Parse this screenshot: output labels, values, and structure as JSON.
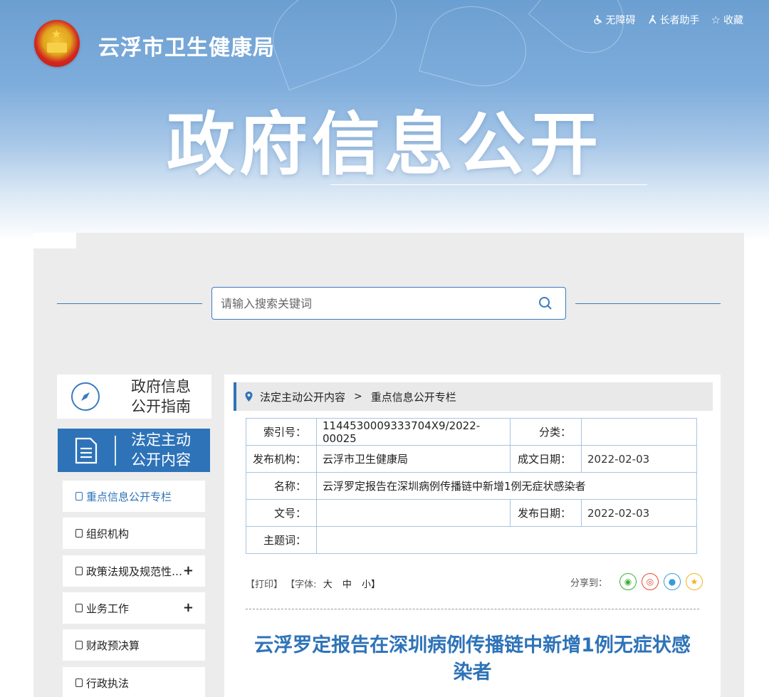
{
  "header": {
    "site_title": "云浮市卫生健康局",
    "hero_title": "政府信息公开",
    "toolbar": [
      {
        "icon": "wheelchair-icon",
        "label": "无障碍"
      },
      {
        "icon": "elderly-icon",
        "label": "长者助手"
      },
      {
        "icon": "star-outline-icon",
        "label": "收藏"
      }
    ]
  },
  "search": {
    "placeholder": "请输入搜索关键词",
    "value": ""
  },
  "sidebar": {
    "guide_label": "政府信息公开指南",
    "legal_label": "法定主动公开内容",
    "items": [
      {
        "label": "重点信息公开专栏",
        "active": true,
        "expand": ""
      },
      {
        "label": "组织机构",
        "active": false,
        "expand": ""
      },
      {
        "label": "政策法规及规范性…",
        "active": false,
        "expand": "+"
      },
      {
        "label": "业务工作",
        "active": false,
        "expand": "+"
      },
      {
        "label": "财政预决算",
        "active": false,
        "expand": ""
      },
      {
        "label": "行政执法",
        "active": false,
        "expand": ""
      }
    ]
  },
  "breadcrumb": {
    "level1": "法定主动公开内容",
    "separator": ">",
    "level2": "重点信息公开专栏"
  },
  "meta": {
    "index_label": "索引号：",
    "index_value": "1144530009333704X9/2022-00025",
    "category_label": "分类：",
    "category_value": "",
    "publisher_label": "发布机构：",
    "publisher_value": "云浮市卫生健康局",
    "written_date_label": "成文日期：",
    "written_date_value": "2022-02-03",
    "name_label": "名称：",
    "name_value": "云浮罗定报告在深圳病例传播链中新增1例无症状感染者",
    "doc_no_label": "文号：",
    "doc_no_value": "",
    "publish_date_label": "发布日期：",
    "publish_date_value": "2022-02-03",
    "keywords_label": "主题词：",
    "keywords_value": ""
  },
  "tools": {
    "print": "【打印】",
    "font_prefix": "【字体:",
    "font_large": "大",
    "font_medium": "中",
    "font_small": "小】",
    "share_label": "分享到："
  },
  "share_icons": [
    "wechat-icon",
    "weibo-icon",
    "qq-icon",
    "qzone-icon"
  ],
  "article": {
    "title": "云浮罗定报告在深圳病例传播链中新增1例无症状感染者"
  },
  "colors": {
    "accent": "#2e73b8",
    "banner": "#7eaddc",
    "panel": "#ececec"
  }
}
